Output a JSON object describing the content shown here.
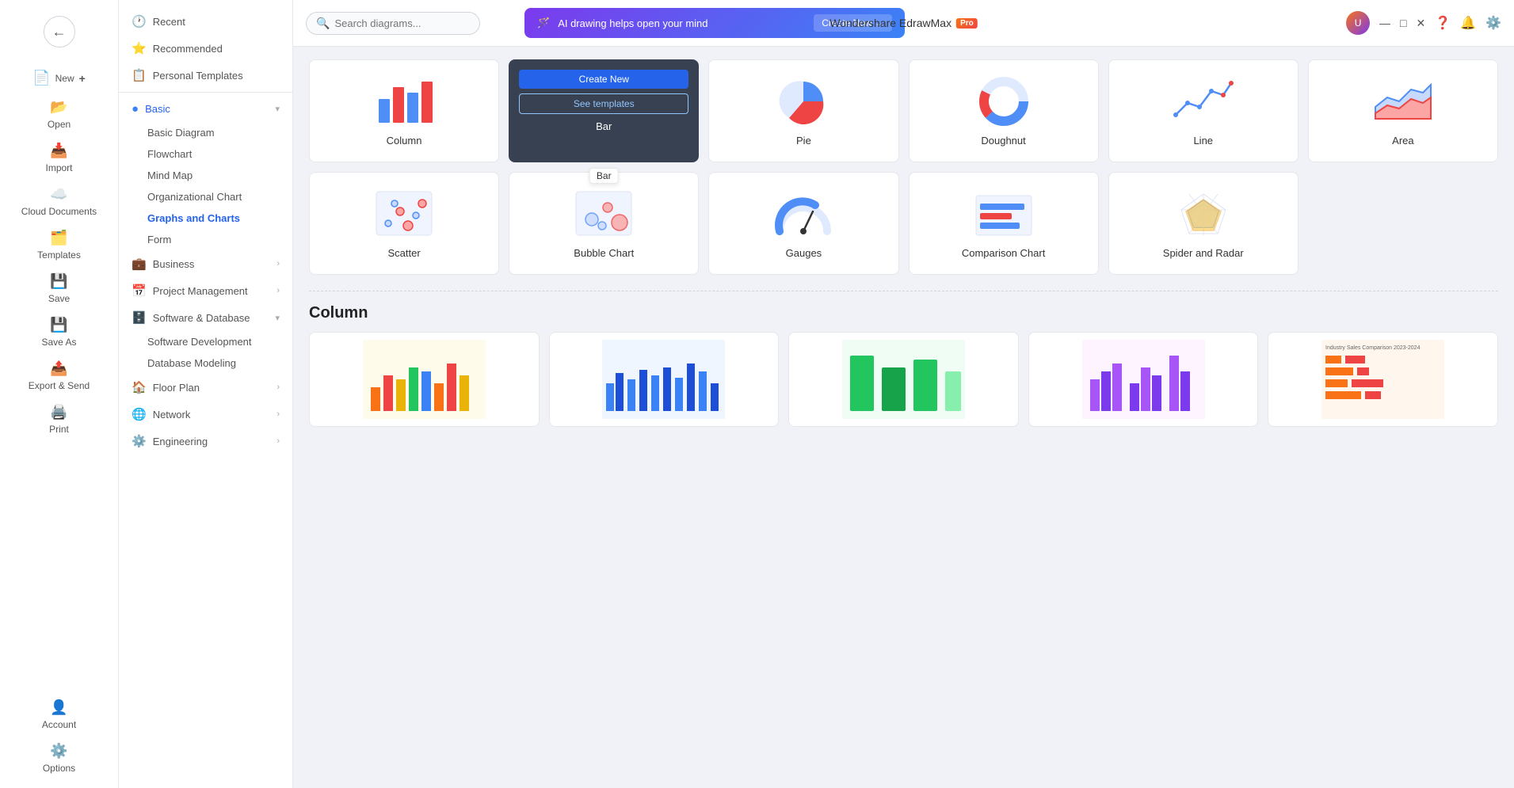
{
  "app": {
    "title": "Wondershare EdrawMax",
    "pro_badge": "Pro"
  },
  "search": {
    "placeholder": "Search diagrams..."
  },
  "ai_banner": {
    "text": "AI drawing helps open your mind",
    "cta": "Create Now →",
    "icon": "🪄"
  },
  "sidebar_narrow": {
    "back_label": "←",
    "items": [
      {
        "id": "new",
        "label": "New",
        "icon": "📄"
      },
      {
        "id": "open",
        "label": "Open",
        "icon": "📂"
      },
      {
        "id": "import",
        "label": "Import",
        "icon": "⬇️"
      },
      {
        "id": "cloud",
        "label": "Cloud Documents",
        "icon": "☁️"
      },
      {
        "id": "templates",
        "label": "Templates",
        "icon": "🗂️"
      },
      {
        "id": "save",
        "label": "Save",
        "icon": "💾"
      },
      {
        "id": "saveas",
        "label": "Save As",
        "icon": "💾"
      },
      {
        "id": "export",
        "label": "Export & Send",
        "icon": "📤"
      },
      {
        "id": "print",
        "label": "Print",
        "icon": "🖨️"
      }
    ],
    "bottom_items": [
      {
        "id": "account",
        "label": "Account",
        "icon": "👤"
      },
      {
        "id": "options",
        "label": "Options",
        "icon": "⚙️"
      }
    ]
  },
  "sidebar_wide": {
    "top_items": [
      {
        "id": "recent",
        "label": "Recent",
        "icon": "🕐",
        "has_chevron": false
      },
      {
        "id": "recommended",
        "label": "Recommended",
        "icon": "⭐",
        "has_chevron": false
      },
      {
        "id": "personal",
        "label": "Personal Templates",
        "icon": "📋",
        "has_chevron": false
      }
    ],
    "categories": [
      {
        "id": "basic",
        "label": "Basic",
        "icon": "📊",
        "expanded": true,
        "color": "#3b82f6",
        "sub_items": [
          {
            "id": "basic-diagram",
            "label": "Basic Diagram"
          },
          {
            "id": "flowchart",
            "label": "Flowchart"
          },
          {
            "id": "mind-map",
            "label": "Mind Map"
          },
          {
            "id": "org-chart",
            "label": "Organizational Chart"
          },
          {
            "id": "graphs-charts",
            "label": "Graphs and Charts",
            "active": true
          },
          {
            "id": "form",
            "label": "Form"
          }
        ]
      },
      {
        "id": "business",
        "label": "Business",
        "icon": "💼",
        "has_chevron": true
      },
      {
        "id": "project-mgmt",
        "label": "Project Management",
        "icon": "📅",
        "has_chevron": true
      },
      {
        "id": "software-db",
        "label": "Software & Database",
        "icon": "🗄️",
        "expanded": true,
        "sub_items": [
          {
            "id": "software-dev",
            "label": "Software Development"
          },
          {
            "id": "db-modeling",
            "label": "Database Modeling"
          }
        ]
      },
      {
        "id": "floor-plan",
        "label": "Floor Plan",
        "icon": "🏠",
        "has_chevron": true
      },
      {
        "id": "network",
        "label": "Network",
        "icon": "🌐",
        "has_chevron": true
      },
      {
        "id": "engineering",
        "label": "Engineering",
        "icon": "⚙️",
        "has_chevron": true
      }
    ]
  },
  "diagram_cards": [
    {
      "id": "column",
      "label": "Column",
      "type": "column",
      "hovered": false
    },
    {
      "id": "bar",
      "label": "Bar",
      "type": "bar",
      "hovered": true,
      "show_actions": true
    },
    {
      "id": "pie",
      "label": "Pie",
      "type": "pie",
      "hovered": false
    },
    {
      "id": "doughnut",
      "label": "Doughnut",
      "type": "doughnut",
      "hovered": false
    },
    {
      "id": "line",
      "label": "Line",
      "type": "line",
      "hovered": false
    },
    {
      "id": "area",
      "label": "Area",
      "type": "area",
      "hovered": false
    },
    {
      "id": "scatter",
      "label": "Scatter",
      "type": "scatter",
      "hovered": false
    },
    {
      "id": "bubble",
      "label": "Bubble Chart",
      "type": "bubble",
      "hovered": false
    },
    {
      "id": "gauges",
      "label": "Gauges",
      "type": "gauges",
      "hovered": false
    },
    {
      "id": "comparison",
      "label": "Comparison Chart",
      "type": "comparison",
      "hovered": false
    },
    {
      "id": "spider",
      "label": "Spider and Radar",
      "type": "spider",
      "hovered": false
    }
  ],
  "card_actions": {
    "create_new": "Create New",
    "see_templates": "See templates"
  },
  "tooltip": {
    "text": "Bar"
  },
  "section": {
    "title": "Column",
    "divider": true
  },
  "top_right": {
    "icons": [
      "❓",
      "🔔",
      "⚙️",
      "🔗",
      "⚙️"
    ]
  }
}
